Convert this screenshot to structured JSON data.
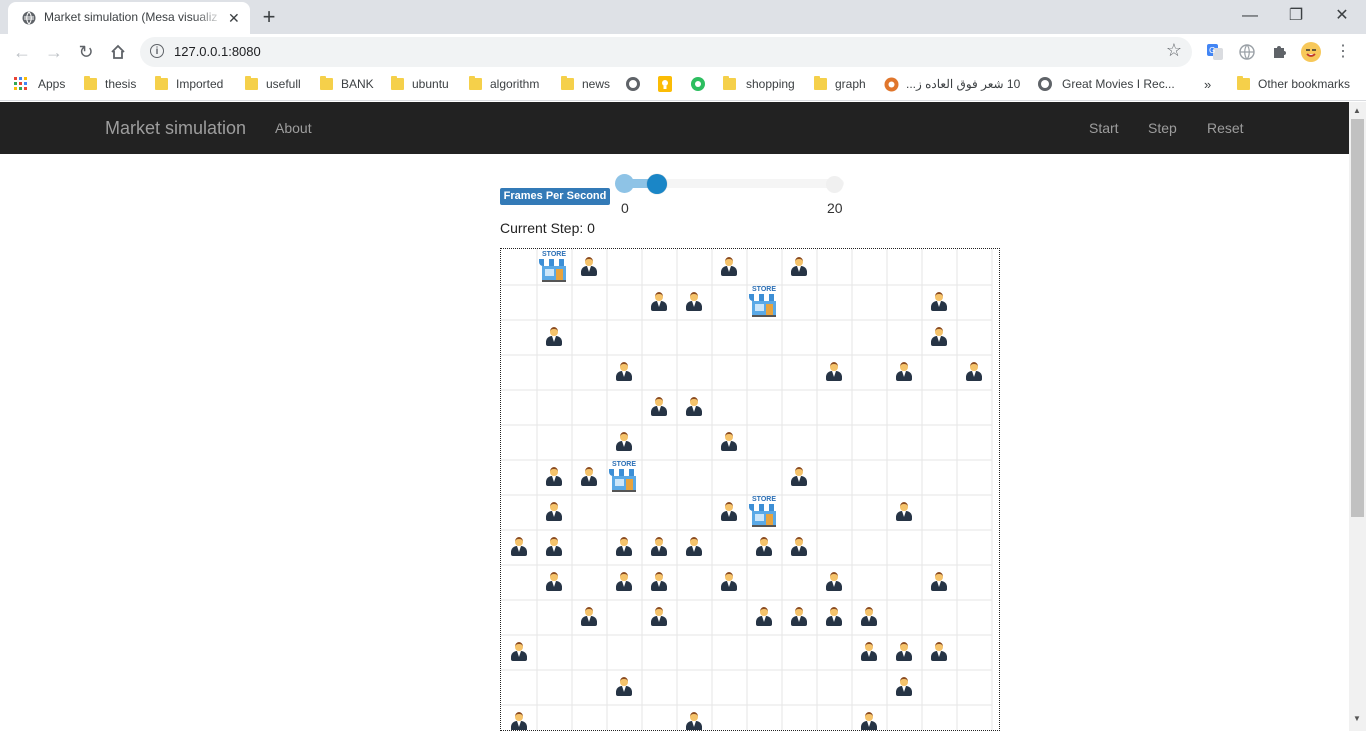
{
  "browser": {
    "tab_title": "Market simulation (Mesa visualiz",
    "url": "127.0.0.1:8080",
    "bookmarks": {
      "apps": "Apps",
      "thesis": "thesis",
      "imported": "Imported",
      "usefull": "usefull",
      "bank": "BANK",
      "ubuntu": "ubuntu",
      "algorithm": "algorithm",
      "news": "news",
      "shopping": "shopping",
      "graph": "graph",
      "arabic": "10 شعر فوق العاده ز...",
      "movies": "Great Movies I Rec...",
      "overflow": "»",
      "other": "Other bookmarks"
    }
  },
  "navbar": {
    "brand": "Market simulation",
    "about": "About",
    "start": "Start",
    "step": "Step",
    "reset": "Reset"
  },
  "controls": {
    "fps_label": "Frames Per Second",
    "fps_min": "0",
    "fps_max": "20",
    "fps_value": 3,
    "current_step_label": "Current Step: 0"
  },
  "grid": {
    "columns": 14,
    "visible_rows": 14,
    "stores": [
      [
        1,
        0
      ],
      [
        7,
        1
      ],
      [
        3,
        6
      ],
      [
        7,
        7
      ]
    ],
    "people": [
      [
        2,
        0
      ],
      [
        6,
        0
      ],
      [
        8,
        0
      ],
      [
        4,
        1
      ],
      [
        5,
        1
      ],
      [
        12,
        1
      ],
      [
        1,
        2
      ],
      [
        12,
        2
      ],
      [
        3,
        3
      ],
      [
        9,
        3
      ],
      [
        11,
        3
      ],
      [
        13,
        3
      ],
      [
        4,
        4
      ],
      [
        5,
        4
      ],
      [
        3,
        5
      ],
      [
        6,
        5
      ],
      [
        1,
        6
      ],
      [
        2,
        6
      ],
      [
        8,
        6
      ],
      [
        1,
        7
      ],
      [
        6,
        7
      ],
      [
        11,
        7
      ],
      [
        0,
        8
      ],
      [
        1,
        8
      ],
      [
        3,
        8
      ],
      [
        4,
        8
      ],
      [
        5,
        8
      ],
      [
        7,
        8
      ],
      [
        8,
        8
      ],
      [
        1,
        9
      ],
      [
        3,
        9
      ],
      [
        4,
        9
      ],
      [
        6,
        9
      ],
      [
        9,
        9
      ],
      [
        12,
        9
      ],
      [
        2,
        10
      ],
      [
        4,
        10
      ],
      [
        7,
        10
      ],
      [
        8,
        10
      ],
      [
        9,
        10
      ],
      [
        10,
        10
      ],
      [
        0,
        11
      ],
      [
        10,
        11
      ],
      [
        11,
        11
      ],
      [
        12,
        11
      ],
      [
        3,
        12
      ],
      [
        11,
        12
      ],
      [
        0,
        13
      ],
      [
        5,
        13
      ],
      [
        10,
        13
      ]
    ]
  },
  "colors": {
    "navbar_bg": "#222222",
    "navbar_text": "#9d9d9d",
    "label_bg": "#337ab7",
    "slider_handle": "#1a86c7"
  }
}
